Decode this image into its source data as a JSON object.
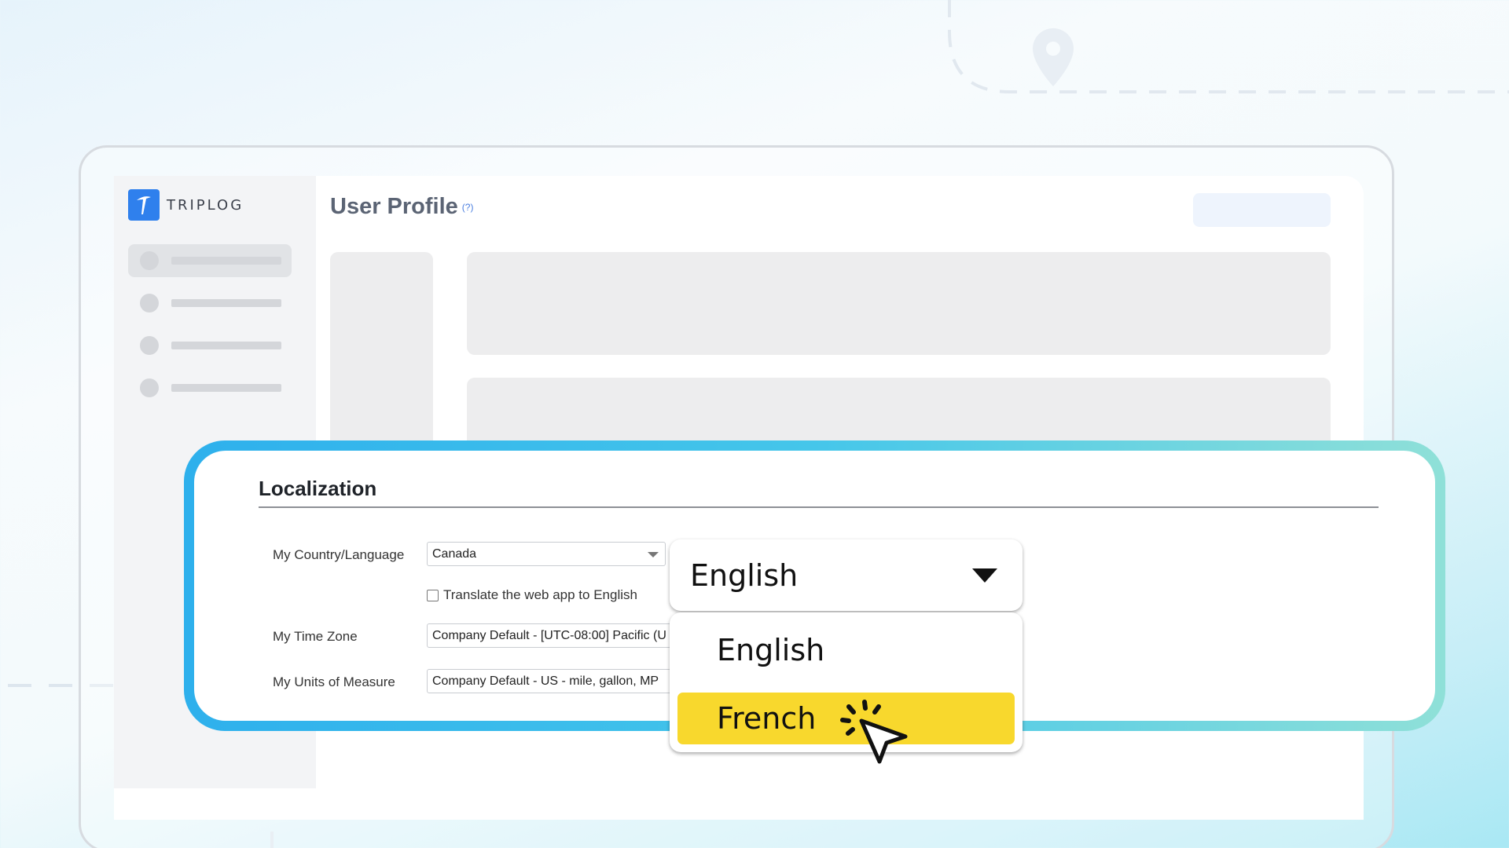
{
  "app": {
    "logo_text": "TRIPLOG",
    "page_title": "User Profile",
    "help_link": "(?)"
  },
  "sidebar": {
    "items": [
      {
        "active": true
      },
      {
        "active": false
      },
      {
        "active": false
      },
      {
        "active": false
      }
    ]
  },
  "localization": {
    "title": "Localization",
    "country_label": "My Country/Language",
    "country_value": "Canada",
    "translate_label": "Translate the web app to English",
    "translate_checked": false,
    "timezone_label": "My Time Zone",
    "timezone_value": "Company Default - [UTC-08:00] Pacific (U",
    "units_label": "My Units of Measure",
    "units_value": "Company Default - US - mile, gallon, MP"
  },
  "language_dropdown": {
    "selected": "English",
    "options": [
      "English",
      "French"
    ],
    "highlighted": "French"
  },
  "colors": {
    "brand_blue": "#2f80ed",
    "highlight_yellow": "#f8d82d",
    "card_border_start": "#2eb0ec",
    "card_border_end": "#8fe0d8"
  }
}
